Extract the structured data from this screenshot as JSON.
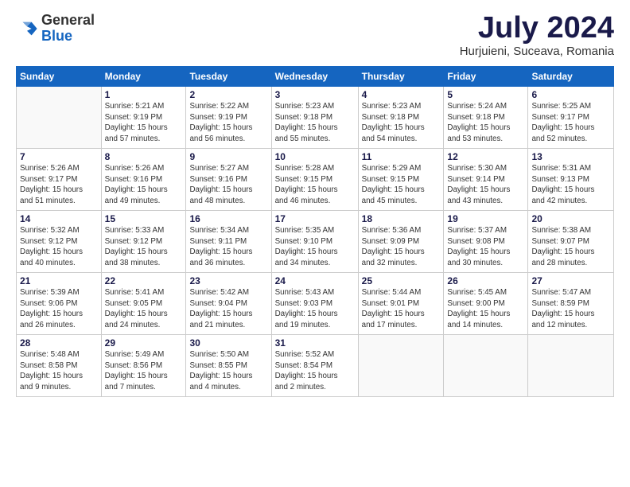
{
  "logo": {
    "general": "General",
    "blue": "Blue"
  },
  "title": "July 2024",
  "location": "Hurjuieni, Suceava, Romania",
  "days_header": [
    "Sunday",
    "Monday",
    "Tuesday",
    "Wednesday",
    "Thursday",
    "Friday",
    "Saturday"
  ],
  "weeks": [
    [
      {
        "day": "",
        "info": ""
      },
      {
        "day": "1",
        "info": "Sunrise: 5:21 AM\nSunset: 9:19 PM\nDaylight: 15 hours\nand 57 minutes."
      },
      {
        "day": "2",
        "info": "Sunrise: 5:22 AM\nSunset: 9:19 PM\nDaylight: 15 hours\nand 56 minutes."
      },
      {
        "day": "3",
        "info": "Sunrise: 5:23 AM\nSunset: 9:18 PM\nDaylight: 15 hours\nand 55 minutes."
      },
      {
        "day": "4",
        "info": "Sunrise: 5:23 AM\nSunset: 9:18 PM\nDaylight: 15 hours\nand 54 minutes."
      },
      {
        "day": "5",
        "info": "Sunrise: 5:24 AM\nSunset: 9:18 PM\nDaylight: 15 hours\nand 53 minutes."
      },
      {
        "day": "6",
        "info": "Sunrise: 5:25 AM\nSunset: 9:17 PM\nDaylight: 15 hours\nand 52 minutes."
      }
    ],
    [
      {
        "day": "7",
        "info": "Sunrise: 5:26 AM\nSunset: 9:17 PM\nDaylight: 15 hours\nand 51 minutes."
      },
      {
        "day": "8",
        "info": "Sunrise: 5:26 AM\nSunset: 9:16 PM\nDaylight: 15 hours\nand 49 minutes."
      },
      {
        "day": "9",
        "info": "Sunrise: 5:27 AM\nSunset: 9:16 PM\nDaylight: 15 hours\nand 48 minutes."
      },
      {
        "day": "10",
        "info": "Sunrise: 5:28 AM\nSunset: 9:15 PM\nDaylight: 15 hours\nand 46 minutes."
      },
      {
        "day": "11",
        "info": "Sunrise: 5:29 AM\nSunset: 9:15 PM\nDaylight: 15 hours\nand 45 minutes."
      },
      {
        "day": "12",
        "info": "Sunrise: 5:30 AM\nSunset: 9:14 PM\nDaylight: 15 hours\nand 43 minutes."
      },
      {
        "day": "13",
        "info": "Sunrise: 5:31 AM\nSunset: 9:13 PM\nDaylight: 15 hours\nand 42 minutes."
      }
    ],
    [
      {
        "day": "14",
        "info": "Sunrise: 5:32 AM\nSunset: 9:12 PM\nDaylight: 15 hours\nand 40 minutes."
      },
      {
        "day": "15",
        "info": "Sunrise: 5:33 AM\nSunset: 9:12 PM\nDaylight: 15 hours\nand 38 minutes."
      },
      {
        "day": "16",
        "info": "Sunrise: 5:34 AM\nSunset: 9:11 PM\nDaylight: 15 hours\nand 36 minutes."
      },
      {
        "day": "17",
        "info": "Sunrise: 5:35 AM\nSunset: 9:10 PM\nDaylight: 15 hours\nand 34 minutes."
      },
      {
        "day": "18",
        "info": "Sunrise: 5:36 AM\nSunset: 9:09 PM\nDaylight: 15 hours\nand 32 minutes."
      },
      {
        "day": "19",
        "info": "Sunrise: 5:37 AM\nSunset: 9:08 PM\nDaylight: 15 hours\nand 30 minutes."
      },
      {
        "day": "20",
        "info": "Sunrise: 5:38 AM\nSunset: 9:07 PM\nDaylight: 15 hours\nand 28 minutes."
      }
    ],
    [
      {
        "day": "21",
        "info": "Sunrise: 5:39 AM\nSunset: 9:06 PM\nDaylight: 15 hours\nand 26 minutes."
      },
      {
        "day": "22",
        "info": "Sunrise: 5:41 AM\nSunset: 9:05 PM\nDaylight: 15 hours\nand 24 minutes."
      },
      {
        "day": "23",
        "info": "Sunrise: 5:42 AM\nSunset: 9:04 PM\nDaylight: 15 hours\nand 21 minutes."
      },
      {
        "day": "24",
        "info": "Sunrise: 5:43 AM\nSunset: 9:03 PM\nDaylight: 15 hours\nand 19 minutes."
      },
      {
        "day": "25",
        "info": "Sunrise: 5:44 AM\nSunset: 9:01 PM\nDaylight: 15 hours\nand 17 minutes."
      },
      {
        "day": "26",
        "info": "Sunrise: 5:45 AM\nSunset: 9:00 PM\nDaylight: 15 hours\nand 14 minutes."
      },
      {
        "day": "27",
        "info": "Sunrise: 5:47 AM\nSunset: 8:59 PM\nDaylight: 15 hours\nand 12 minutes."
      }
    ],
    [
      {
        "day": "28",
        "info": "Sunrise: 5:48 AM\nSunset: 8:58 PM\nDaylight: 15 hours\nand 9 minutes."
      },
      {
        "day": "29",
        "info": "Sunrise: 5:49 AM\nSunset: 8:56 PM\nDaylight: 15 hours\nand 7 minutes."
      },
      {
        "day": "30",
        "info": "Sunrise: 5:50 AM\nSunset: 8:55 PM\nDaylight: 15 hours\nand 4 minutes."
      },
      {
        "day": "31",
        "info": "Sunrise: 5:52 AM\nSunset: 8:54 PM\nDaylight: 15 hours\nand 2 minutes."
      },
      {
        "day": "",
        "info": ""
      },
      {
        "day": "",
        "info": ""
      },
      {
        "day": "",
        "info": ""
      }
    ]
  ]
}
